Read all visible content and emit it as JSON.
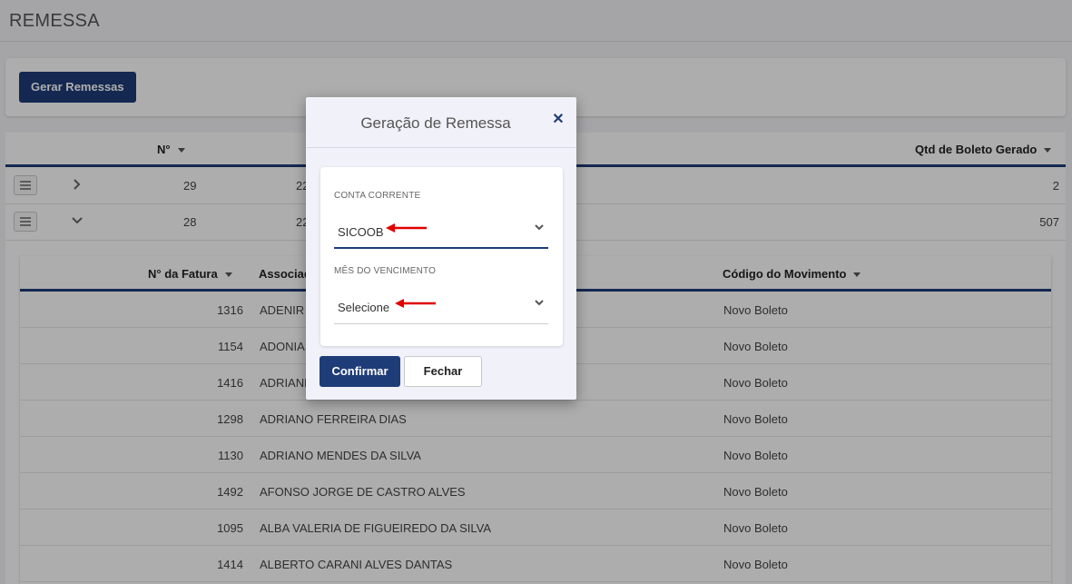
{
  "page": {
    "title": "REMESSA"
  },
  "toolbar": {
    "gerar_label": "Gerar Remessas"
  },
  "outer_table": {
    "col_numero": "N°",
    "col_qtd": "Qtd de Boleto Gerado",
    "rows": [
      {
        "numero": "29",
        "partial": "22",
        "qtd": "2",
        "expanded": false
      },
      {
        "numero": "28",
        "partial": "22",
        "qtd": "507",
        "expanded": true
      }
    ]
  },
  "inner_table": {
    "col_fatura": "N° da Fatura",
    "col_associado": "Associado",
    "col_movimento": "Código do Movimento",
    "rows": [
      {
        "fatura": "1316",
        "nome": "ADENIR A",
        "movimento": "Novo Boleto"
      },
      {
        "fatura": "1154",
        "nome": "ADONIAS",
        "movimento": "Novo Boleto"
      },
      {
        "fatura": "1416",
        "nome": "ADRIANE",
        "movimento": "Novo Boleto"
      },
      {
        "fatura": "1298",
        "nome": "ADRIANO FERREIRA DIAS",
        "movimento": "Novo Boleto"
      },
      {
        "fatura": "1130",
        "nome": "ADRIANO MENDES DA SILVA",
        "movimento": "Novo Boleto"
      },
      {
        "fatura": "1492",
        "nome": "AFONSO JORGE DE CASTRO ALVES",
        "movimento": "Novo Boleto"
      },
      {
        "fatura": "1095",
        "nome": "ALBA VALERIA DE FIGUEIREDO DA SILVA",
        "movimento": "Novo Boleto"
      },
      {
        "fatura": "1414",
        "nome": "ALBERTO CARANI ALVES DANTAS",
        "movimento": "Novo Boleto"
      }
    ]
  },
  "modal": {
    "title": "Geração de Remessa",
    "close_icon": "close-icon",
    "conta_label": "CONTA CORRENTE",
    "conta_value": "SICOOB",
    "mes_label": "MÊS DO VENCIMENTO",
    "mes_value": "Selecione",
    "confirm_label": "Confirmar",
    "fechar_label": "Fechar"
  },
  "colors": {
    "primary": "#1e3c78",
    "annotation_arrow": "#e00000"
  }
}
